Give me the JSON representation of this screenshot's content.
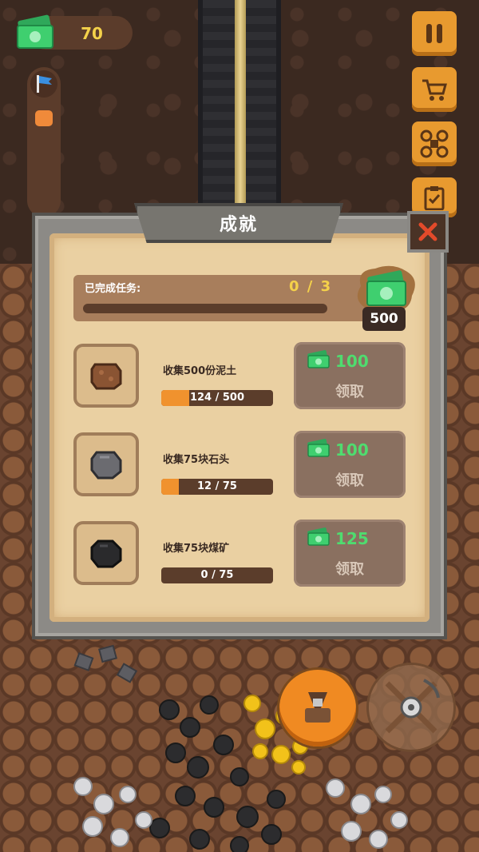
{
  "hud": {
    "money": "70"
  },
  "achievements": {
    "title": "成就",
    "completed_label": "已完成任务:",
    "completed_count": "0 / 3",
    "completed_fraction": 0,
    "reward": "500",
    "tasks": [
      {
        "name": "收集500份泥土",
        "progress_text": "124 / 500",
        "progress": 0.248,
        "reward": "100",
        "claim_label": "领取",
        "item": "dirt"
      },
      {
        "name": "收集75块石头",
        "progress_text": "12 / 75",
        "progress": 0.16,
        "reward": "100",
        "claim_label": "领取",
        "item": "stone"
      },
      {
        "name": "收集75块煤矿",
        "progress_text": "0 / 75",
        "progress": 0,
        "reward": "125",
        "claim_label": "领取",
        "item": "coal"
      }
    ]
  },
  "icons": {
    "money": "cash-stack-icon",
    "flag": "flag-icon",
    "pause": "pause-icon",
    "shop": "cart-icon",
    "drone": "drone-icon",
    "tasks": "clipboard-icon",
    "close": "close-icon",
    "drill": "drill-icon",
    "pickaxe": "pickaxe-icon"
  },
  "colors": {
    "accent_orange": "#e89a2f",
    "money_yellow": "#f4d14a",
    "reward_green": "#4fdc6f",
    "progress_orange": "#f0922e"
  }
}
